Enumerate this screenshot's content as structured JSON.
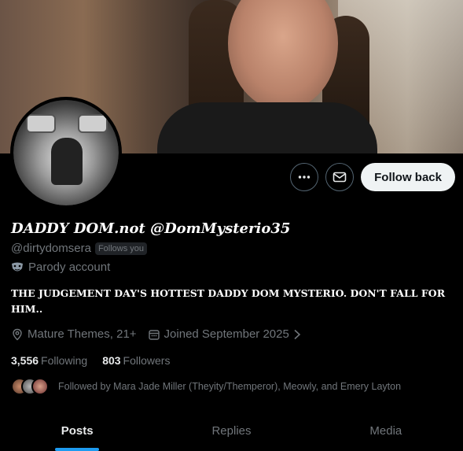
{
  "profile": {
    "display_name": "DADDY DOM.not @DomMysterio35",
    "handle": "@dirtydomsera",
    "follows_you": "Follows you",
    "parody_label": "Parody account",
    "bio": "THE JUDGEMENT DAY'S HOTTEST DADDY DOM MYSTERIO. DON'T FALL FOR HIM..",
    "location": "Mature Themes, 21+",
    "joined": "Joined September 2025",
    "following_count": "3,556",
    "following_label": "Following",
    "followers_count": "803",
    "followers_label": "Followers",
    "followed_by": "Followed by Mara Jade Miller (Theyity/Themperor), Meowly, and Emery Layton"
  },
  "actions": {
    "more_icon": "more-horizontal-icon",
    "message_icon": "envelope-icon",
    "follow_label": "Follow back"
  },
  "tabs": [
    {
      "label": "Posts",
      "active": true
    },
    {
      "label": "Replies",
      "active": false
    },
    {
      "label": "Media",
      "active": false
    }
  ],
  "colors": {
    "background": "#000000",
    "accent": "#1d9bf0",
    "secondary_text": "#71767b"
  }
}
